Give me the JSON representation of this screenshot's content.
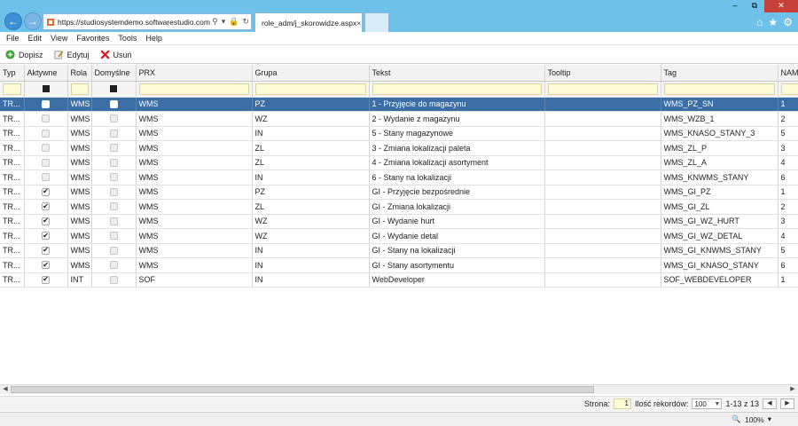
{
  "browser": {
    "url": "https://studiosystemdemo.softwarestudio.com.pl/",
    "tab_title": "role_adm/j_skorowidze.aspx",
    "win_min": "–",
    "win_max": "⧉",
    "win_close": "✕"
  },
  "menu": [
    "File",
    "Edit",
    "View",
    "Favorites",
    "Tools",
    "Help"
  ],
  "toolbar": {
    "add_label": "Dopisz",
    "edit_label": "Edytuj",
    "delete_label": "Usuń"
  },
  "columns": [
    "Typ",
    "Aktywne",
    "Rola",
    "Domyślne",
    "PRX",
    "Grupa",
    "Tekst",
    "Tooltip",
    "Tag",
    "NAME"
  ],
  "rows": [
    {
      "typ": "TR...",
      "aktywne": false,
      "rola": "WMS",
      "domyslne": false,
      "prx": "WMS",
      "grupa": "PZ",
      "tekst": "1 - Przyjęcie do magazynu",
      "tooltip": "",
      "tag": "WMS_PZ_SN",
      "name": "1",
      "selected": true
    },
    {
      "typ": "TR...",
      "aktywne": false,
      "rola": "WMS",
      "domyslne": false,
      "prx": "WMS",
      "grupa": "WZ",
      "tekst": "2 - Wydanie z magazynu",
      "tooltip": "",
      "tag": "WMS_WZB_1",
      "name": "2"
    },
    {
      "typ": "TR...",
      "aktywne": false,
      "rola": "WMS",
      "domyslne": false,
      "prx": "WMS",
      "grupa": "IN",
      "tekst": "5 - Stany magazynowe",
      "tooltip": "",
      "tag": "WMS_KNASO_STANY_3",
      "name": "5"
    },
    {
      "typ": "TR...",
      "aktywne": false,
      "rola": "WMS",
      "domyslne": false,
      "prx": "WMS",
      "grupa": "ZL",
      "tekst": "3 - Zmiana lokalizacji paleta",
      "tooltip": "",
      "tag": "WMS_ZL_P",
      "name": "3"
    },
    {
      "typ": "TR...",
      "aktywne": false,
      "rola": "WMS",
      "domyslne": false,
      "prx": "WMS",
      "grupa": "ZL",
      "tekst": "4 - Zmiana lokalizacji asortyment",
      "tooltip": "",
      "tag": "WMS_ZL_A",
      "name": "4"
    },
    {
      "typ": "TR...",
      "aktywne": false,
      "rola": "WMS",
      "domyslne": false,
      "prx": "WMS",
      "grupa": "IN",
      "tekst": "6 - Stany na lokalizacji",
      "tooltip": "",
      "tag": "WMS_KNWMS_STANY",
      "name": "6"
    },
    {
      "typ": "TR...",
      "aktywne": true,
      "rola": "WMS",
      "domyslne": false,
      "prx": "WMS",
      "grupa": "PZ",
      "tekst": "GI - Przyjęcie bezpośrednie",
      "tooltip": "",
      "tag": "WMS_GI_PZ",
      "name": "1"
    },
    {
      "typ": "TR...",
      "aktywne": true,
      "rola": "WMS",
      "domyslne": false,
      "prx": "WMS",
      "grupa": "ZL",
      "tekst": "GI - Zmiana lokalizacji",
      "tooltip": "",
      "tag": "WMS_GI_ZL",
      "name": "2"
    },
    {
      "typ": "TR...",
      "aktywne": true,
      "rola": "WMS",
      "domyslne": false,
      "prx": "WMS",
      "grupa": "WZ",
      "tekst": "GI - Wydanie hurt",
      "tooltip": "",
      "tag": "WMS_GI_WZ_HURT",
      "name": "3"
    },
    {
      "typ": "TR...",
      "aktywne": true,
      "rola": "WMS",
      "domyslne": false,
      "prx": "WMS",
      "grupa": "WZ",
      "tekst": "GI - Wydanie detal",
      "tooltip": "",
      "tag": "WMS_GI_WZ_DETAL",
      "name": "4"
    },
    {
      "typ": "TR...",
      "aktywne": true,
      "rola": "WMS",
      "domyslne": false,
      "prx": "WMS",
      "grupa": "IN",
      "tekst": "GI - Stany na lokalizacji",
      "tooltip": "",
      "tag": "WMS_GI_KNWMS_STANY",
      "name": "5"
    },
    {
      "typ": "TR...",
      "aktywne": true,
      "rola": "WMS",
      "domyslne": false,
      "prx": "WMS",
      "grupa": "IN",
      "tekst": "GI - Stany asortymentu",
      "tooltip": "",
      "tag": "WMS_GI_KNASO_STANY",
      "name": "6"
    },
    {
      "typ": "TR...",
      "aktywne": true,
      "rola": "INT",
      "domyslne": false,
      "prx": "SOF",
      "grupa": "IN",
      "tekst": "WebDeveloper",
      "tooltip": "",
      "tag": "SOF_WEBDEVELOPER",
      "name": "1"
    }
  ],
  "pager": {
    "page_label": "Strona:",
    "page_value": "1",
    "records_label": "Ilość rekordów:",
    "records_value": "100",
    "range_text": "1-13 z 13"
  },
  "status": {
    "zoom": "100%"
  },
  "colors": {
    "titlebar": "#6ec1e8",
    "selection": "#3a6ea5",
    "filter_bg": "#fffbd6",
    "close_button": "#c7413b"
  }
}
